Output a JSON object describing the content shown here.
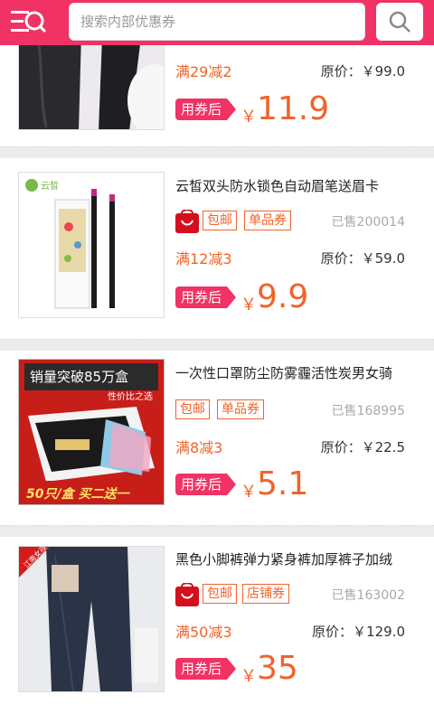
{
  "topbar": {
    "search_placeholder": "搜索内部优惠券"
  },
  "items": [
    {
      "title": "",
      "tags": [],
      "sold": "",
      "discount": "满29减2",
      "original": "原价：￥99.0",
      "after_label": "用券后",
      "currency": "￥",
      "price": "11.9"
    },
    {
      "title": "云皙双头防水锁色自动眉笔送眉卡",
      "tags": [
        "包邮",
        "单品券"
      ],
      "sold": "已售200014",
      "discount": "满12减3",
      "original": "原价：￥59.0",
      "after_label": "用券后",
      "currency": "￥",
      "price": "9.9",
      "brand_text": "云皙"
    },
    {
      "title": "一次性口罩防尘防雾霾活性炭男女骑",
      "tags": [
        "包邮",
        "单品券"
      ],
      "sold": "已售168995",
      "discount": "满8减3",
      "original": "原价：￥22.5",
      "after_label": "用券后",
      "currency": "￥",
      "price": "5.1",
      "banner_top": "销量突破85万盒",
      "banner_sub": "性价比之选",
      "banner_bottom": "50只/盒 买二送一"
    },
    {
      "title": "黑色小脚裤弹力紧身裤加厚裤子加绒",
      "tags": [
        "包邮",
        "店铺券"
      ],
      "sold": "已售163002",
      "discount": "满50减3",
      "original": "原价：￥129.0",
      "after_label": "用券后",
      "currency": "￥",
      "price": "35",
      "ribbon": "江南女孩"
    }
  ],
  "colors": {
    "brand": "#f03264",
    "accent": "#f0632a"
  }
}
